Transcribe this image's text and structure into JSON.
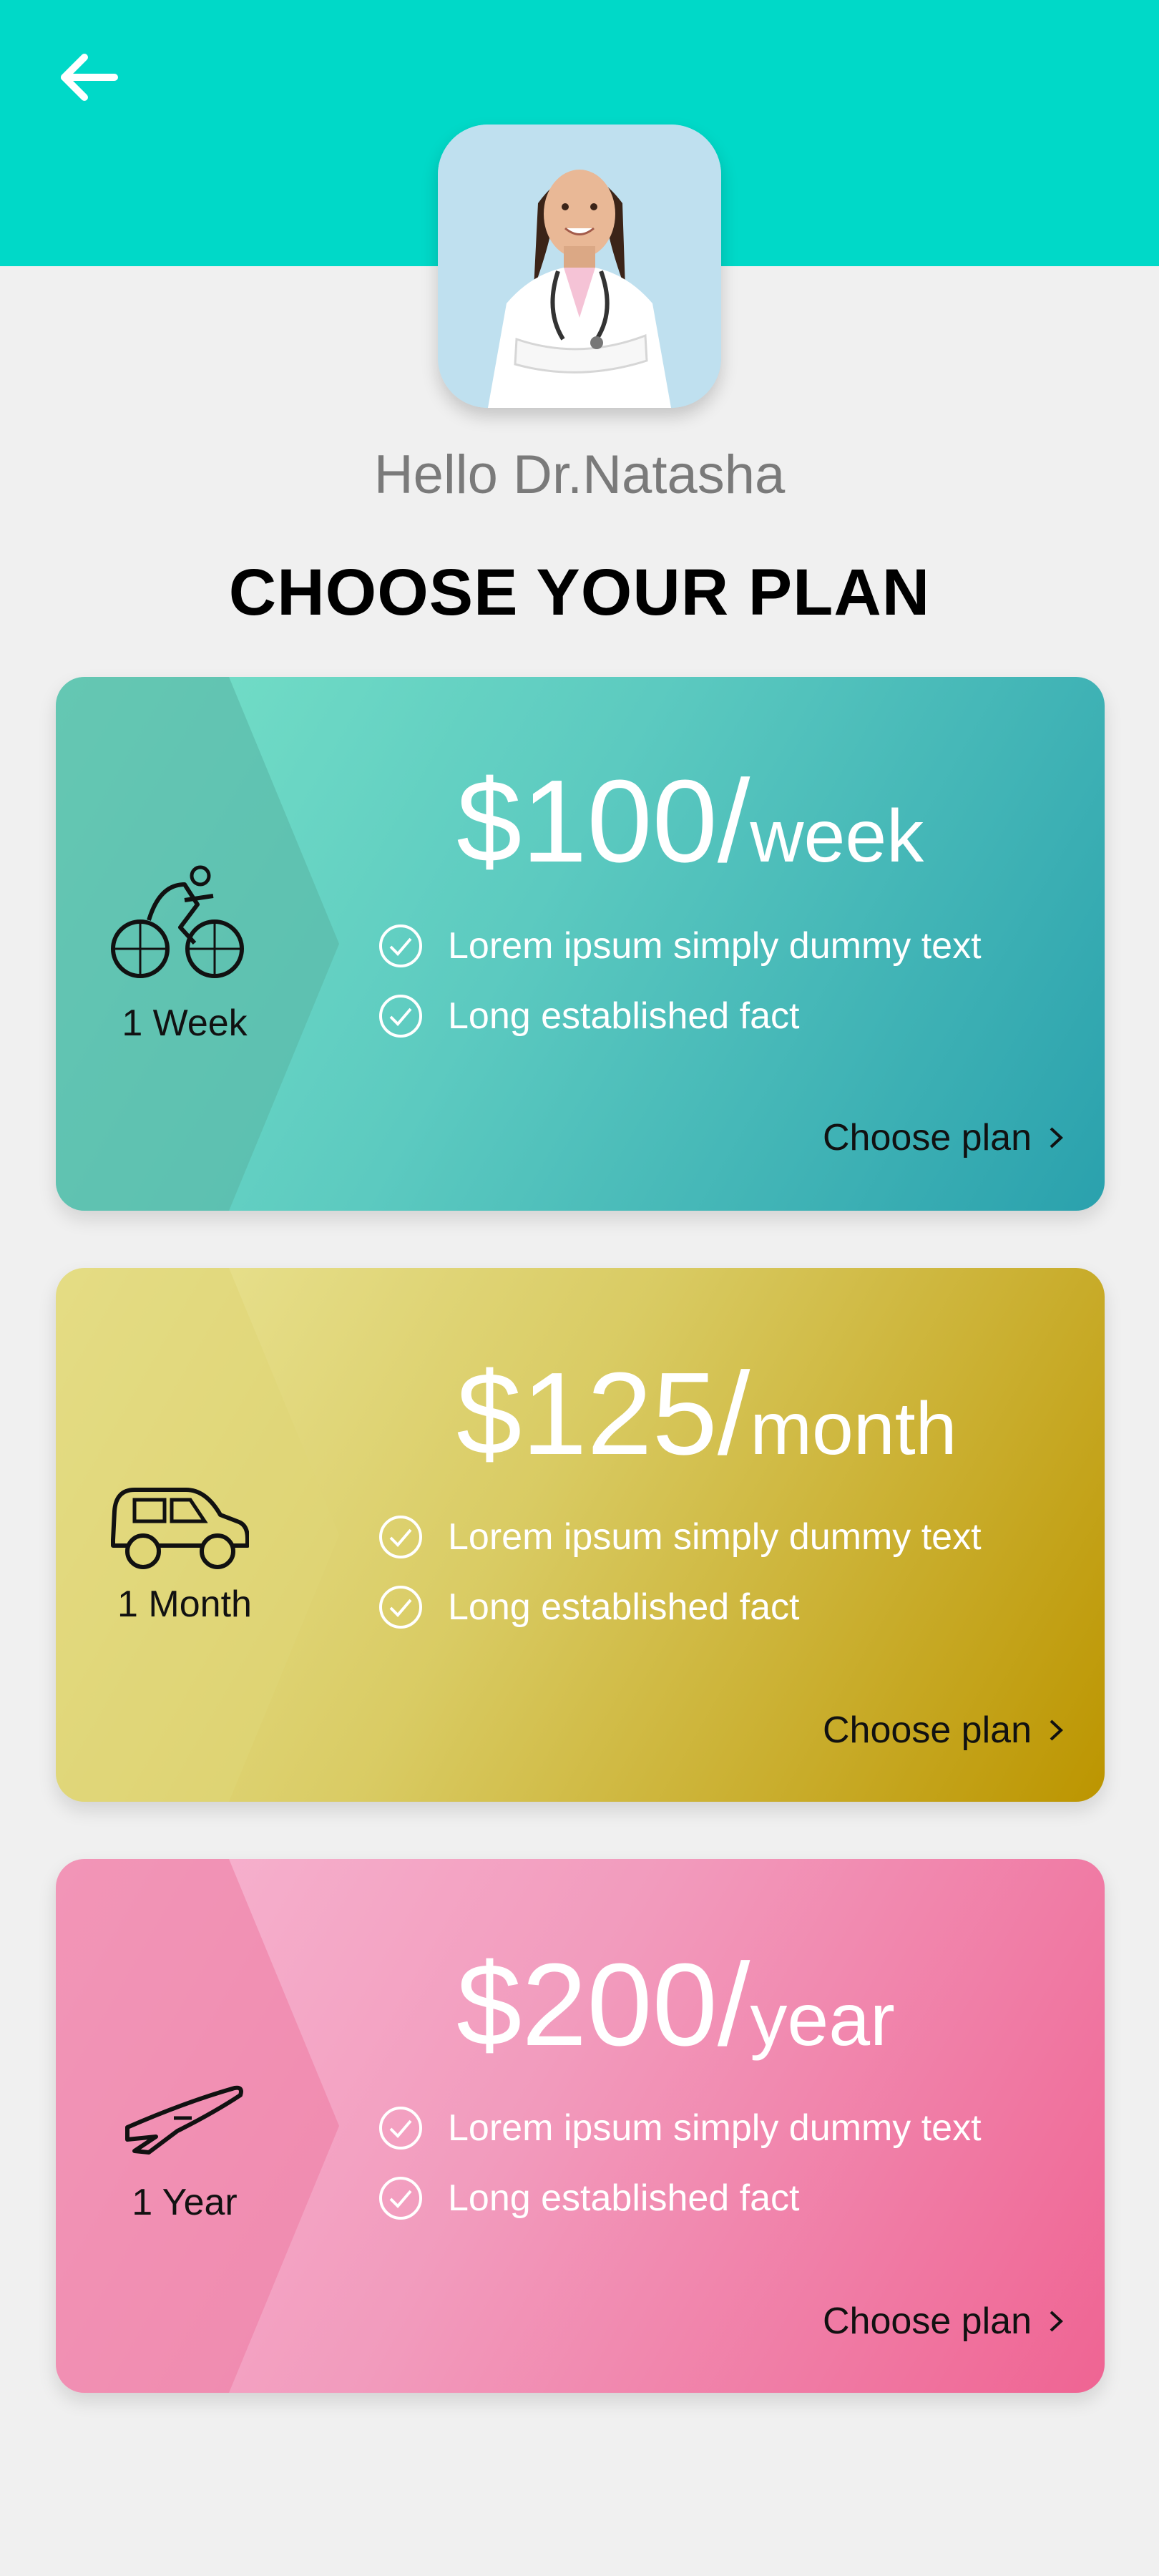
{
  "header": {
    "back_icon": "arrow-left-icon",
    "background": "#00d9c8"
  },
  "profile": {
    "greeting": "Hello Dr.Natasha",
    "avatar_alt": "doctor-photo"
  },
  "page_title": "CHOOSE YOUR PLAN",
  "plans": [
    {
      "icon": "bicycle-icon",
      "duration": "1 Week",
      "price": "$100/",
      "period": "week",
      "features": [
        "Lorem ipsum simply dummy text",
        "Long established fact"
      ],
      "cta": "Choose plan",
      "colors": {
        "from": "#6bdcc3",
        "to": "#2aa0ac"
      }
    },
    {
      "icon": "car-icon",
      "duration": "1 Month",
      "price": "$125/",
      "period": "month",
      "features": [
        "Lorem ipsum simply dummy text",
        "Long established fact"
      ],
      "cta": "Choose plan",
      "colors": {
        "from": "#e7e39a",
        "to": "#bf9700"
      }
    },
    {
      "icon": "airplane-icon",
      "duration": "1 Year",
      "price": "$200/",
      "period": "year",
      "features": [
        "Lorem ipsum simply dummy text",
        "Long established fact"
      ],
      "cta": "Choose plan",
      "colors": {
        "from": "#f5b2cf",
        "to": "#ef6694"
      }
    }
  ]
}
